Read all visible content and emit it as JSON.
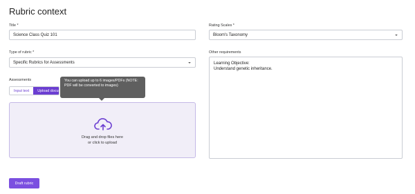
{
  "page_title": "Rubric context",
  "title_field": {
    "label": "Title",
    "required_mark": "*",
    "value": "Science Class Quiz 101"
  },
  "rating_scales": {
    "label": "Rating Scales",
    "required_mark": "*",
    "value": "Bloom's Taxonomy"
  },
  "rubric_type": {
    "label": "Type of rubric",
    "required_mark": "*",
    "value": "Specific Rubrics for Assessments"
  },
  "other_requirements": {
    "label": "Other requirements",
    "value": "Learning Objective:\nUnderstand genetic inheritance."
  },
  "assessments": {
    "label": "Assessments",
    "tabs": [
      {
        "label": "Input text",
        "active": false
      },
      {
        "label": "Upload document",
        "active": true
      }
    ],
    "tooltip": "You can upload up to 6 images/PDFs (NOTE: PDF will be converted to images)",
    "dropzone_line1": "Drag and drop files here",
    "dropzone_line2": "or click to upload",
    "upload_icon": "cloud-upload-icon"
  },
  "draft_button": "Draft rubric",
  "colors": {
    "accent": "#6b3ed1",
    "button": "#7b4fe0",
    "dropzone_bg": "#f1eef8",
    "tooltip_bg": "#5f5f5f"
  }
}
